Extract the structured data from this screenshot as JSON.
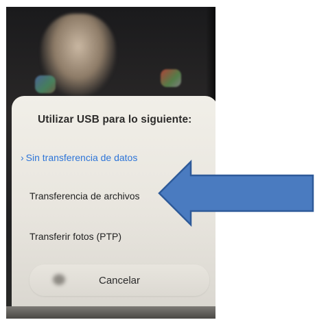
{
  "dialog": {
    "title": "Utilizar USB para lo siguiente:",
    "options": [
      {
        "label": "Sin transferencia de datos",
        "selected": true,
        "marker": "›"
      },
      {
        "label": "Transferencia de archivos",
        "selected": false
      },
      {
        "label": "Transferir fotos (PTP)",
        "selected": false
      }
    ],
    "cancel_label": "Cancelar"
  },
  "colors": {
    "selected_option": "#2d74d8",
    "arrow_fill": "#4a7bc0",
    "arrow_stroke": "#2e5a99"
  },
  "annotation": {
    "arrow_icon": "left-arrow-icon"
  }
}
